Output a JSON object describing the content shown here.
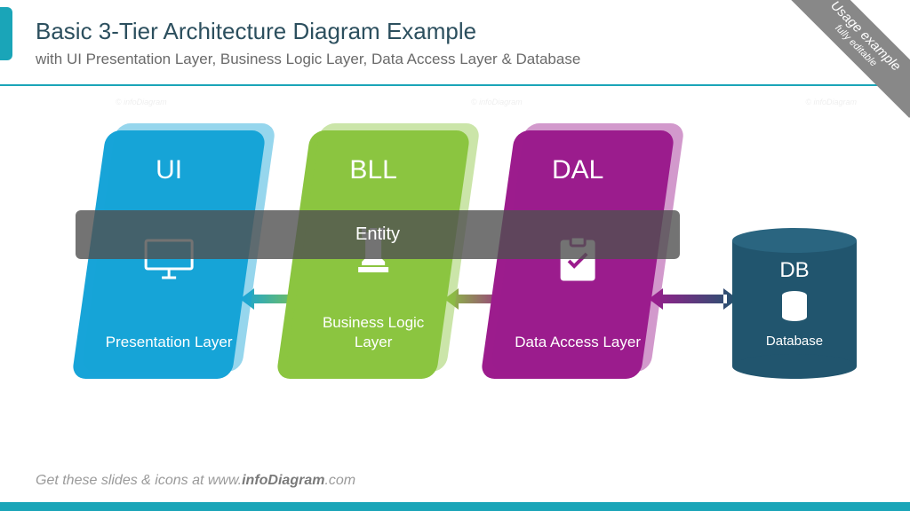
{
  "header": {
    "title": "Basic 3-Tier Architecture Diagram Example",
    "subtitle": "with UI Presentation Layer, Business Logic Layer, Data Access Layer & Database"
  },
  "ribbon": {
    "line1": "Usage example",
    "line2": "fully editable"
  },
  "tiers": {
    "ui": {
      "abbr": "UI",
      "label": "Presentation Layer"
    },
    "bll": {
      "abbr": "BLL",
      "label": "Business Logic Layer"
    },
    "dal": {
      "abbr": "DAL",
      "label": "Data Access Layer"
    }
  },
  "entity": {
    "label": "Entity"
  },
  "database": {
    "abbr": "DB",
    "label": "Database"
  },
  "footer": {
    "prefix": "Get these slides & icons at www.",
    "brand": "infoDiagram",
    "suffix": ".com"
  },
  "watermark": "© infoDiagram"
}
